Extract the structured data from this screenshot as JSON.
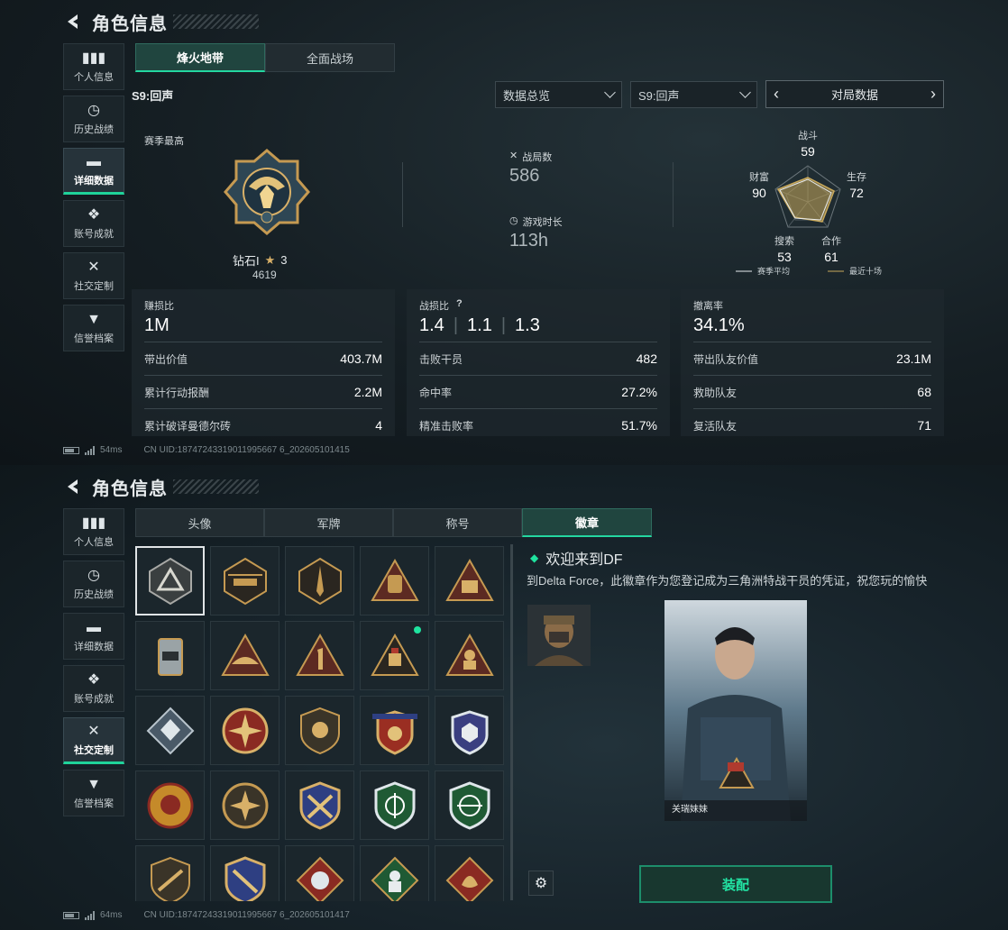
{
  "panel1": {
    "header": {
      "title": "角色信息"
    },
    "nav": [
      {
        "label": "个人信息",
        "icon": "bar-chart-icon"
      },
      {
        "label": "历史战绩",
        "icon": "clock-icon"
      },
      {
        "label": "详细数据",
        "icon": "folder-icon",
        "active": true
      },
      {
        "label": "账号成就",
        "icon": "medal-icon"
      },
      {
        "label": "社交定制",
        "icon": "tools-icon"
      },
      {
        "label": "信誉档案",
        "icon": "shield-icon"
      }
    ],
    "tabs": [
      {
        "label": "烽火地带",
        "active": true
      },
      {
        "label": "全面战场"
      }
    ],
    "season_label": "S9:回声",
    "dropdown1": "数据总览",
    "dropdown2": "S9:回声",
    "pager_label": "对局数据",
    "rank": {
      "caption": "赛季最高",
      "name": "钻石I",
      "stars": "3",
      "score": "4619"
    },
    "matches": {
      "label": "战局数",
      "value": "586"
    },
    "playtime": {
      "label": "游戏时长",
      "value": "113h"
    },
    "radar": {
      "axes": [
        {
          "name": "战斗",
          "value": "59"
        },
        {
          "name": "生存",
          "value": "72"
        },
        {
          "name": "合作",
          "value": "61"
        },
        {
          "name": "搜索",
          "value": "53"
        },
        {
          "name": "财富",
          "value": "90"
        }
      ],
      "legend": [
        {
          "label": "赛季平均",
          "color": "#e8ecee"
        },
        {
          "label": "最近十场",
          "color": "#c9a95b"
        }
      ]
    },
    "card1": {
      "label": "赚损比",
      "value": "1M",
      "rows": [
        {
          "k": "带出价值",
          "v": "403.7M"
        },
        {
          "k": "累计行动报酬",
          "v": "2.2M"
        },
        {
          "k": "累计破译曼德尔砖",
          "v": "4"
        }
      ]
    },
    "card2": {
      "label": "战损比",
      "help": "?",
      "values": [
        "1.4",
        "1.1",
        "1.3"
      ],
      "rows": [
        {
          "k": "击败干员",
          "v": "482"
        },
        {
          "k": "命中率",
          "v": "27.2%"
        },
        {
          "k": "精准击败率",
          "v": "51.7%"
        }
      ]
    },
    "card3": {
      "label": "撤离率",
      "value": "34.1%",
      "rows": [
        {
          "k": "带出队友价值",
          "v": "23.1M"
        },
        {
          "k": "救助队友",
          "v": "68"
        },
        {
          "k": "复活队友",
          "v": "71"
        }
      ]
    },
    "status": {
      "ping": "54ms",
      "uid": "CN UID:18747243319011995667 6_202605101415"
    }
  },
  "panel2": {
    "header": {
      "title": "角色信息"
    },
    "nav": [
      {
        "label": "个人信息",
        "icon": "bar-chart-icon"
      },
      {
        "label": "历史战绩",
        "icon": "clock-icon"
      },
      {
        "label": "详细数据",
        "icon": "folder-icon"
      },
      {
        "label": "账号成就",
        "icon": "medal-icon"
      },
      {
        "label": "社交定制",
        "icon": "tools-icon",
        "active": true
      },
      {
        "label": "信誉档案",
        "icon": "shield-icon"
      }
    ],
    "tabs": [
      {
        "label": "头像"
      },
      {
        "label": "军牌"
      },
      {
        "label": "称号"
      },
      {
        "label": "徽章",
        "active": true
      }
    ],
    "detail": {
      "title": "欢迎来到DF",
      "desc": "到Delta Force，此徽章作为您登记成为三角洲特战干员的凭证，祝您玩的愉快",
      "preview_name": "关瑞妹妹"
    },
    "equip_label": "装配",
    "status": {
      "ping": "64ms",
      "uid": "CN UID:18747243319011995667 6_202605101417"
    }
  }
}
